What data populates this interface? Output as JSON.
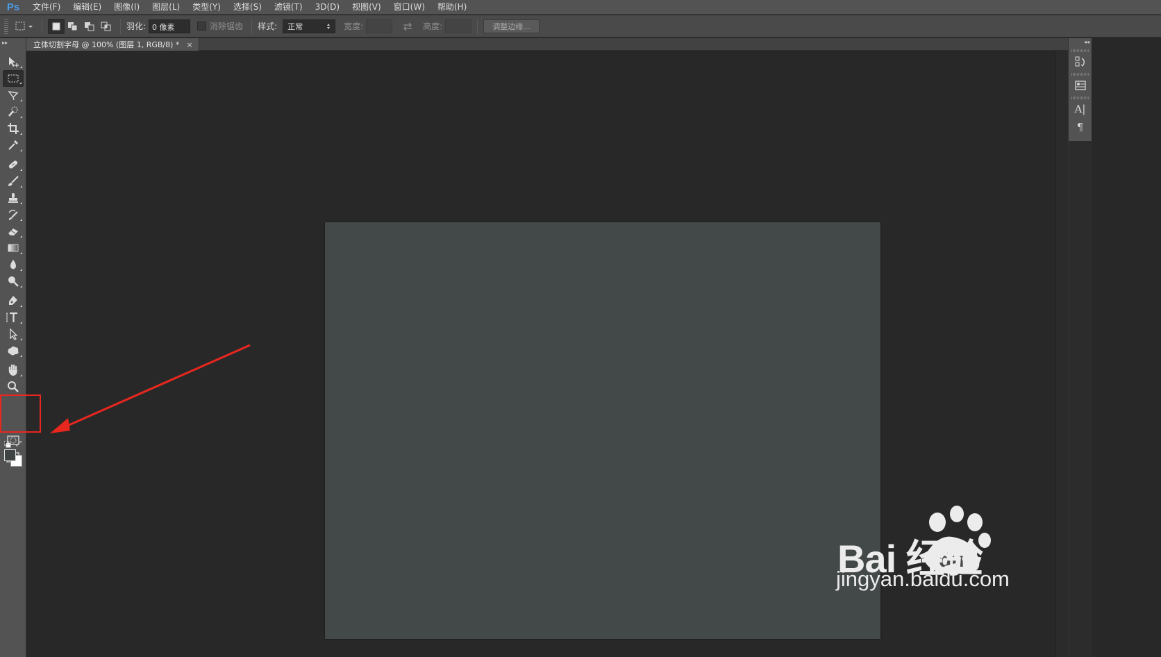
{
  "app": {
    "logo": "Ps"
  },
  "menu": [
    "文件(F)",
    "编辑(E)",
    "图像(I)",
    "图层(L)",
    "类型(Y)",
    "选择(S)",
    "滤镜(T)",
    "3D(D)",
    "视图(V)",
    "窗口(W)",
    "帮助(H)"
  ],
  "options_bar": {
    "feather_label": "羽化:",
    "feather_value": "0 像素",
    "antialias_label": "消除锯齿",
    "style_label": "样式:",
    "style_value": "正常",
    "width_label": "宽度:",
    "height_label": "高度:",
    "refine_edge_button": "调整边缘..."
  },
  "document_tab": {
    "title": "立体切割字母 @ 100% (图层 1, RGB/8) *",
    "close": "×"
  },
  "colors": {
    "foreground": "#3f4545",
    "background": "#ffffff",
    "document_fill": "#434848",
    "annotation": "#e8271f"
  },
  "tools": [
    "move-tool",
    "rectangular-marquee-tool",
    "lasso-tool",
    "quick-selection-tool",
    "crop-tool",
    "eyedropper-tool",
    "spot-healing-brush-tool",
    "brush-tool",
    "clone-stamp-tool",
    "history-brush-tool",
    "eraser-tool",
    "gradient-tool",
    "blur-tool",
    "dodge-tool",
    "pen-tool",
    "type-tool",
    "path-selection-tool",
    "shape-tool",
    "hand-tool",
    "zoom-tool",
    "quick-mask-mode",
    "screen-mode"
  ],
  "right_dock_icons": [
    "history-icon",
    "properties-icon",
    "character-icon",
    "paragraph-icon"
  ],
  "watermark": {
    "brand": "Bai  经验",
    "site": "jingyan.baidu.com"
  }
}
